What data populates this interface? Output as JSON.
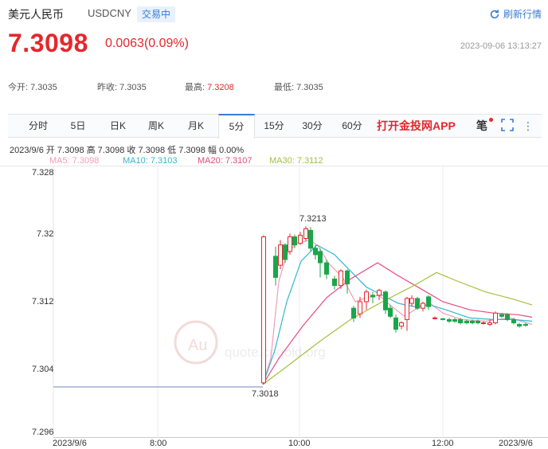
{
  "header": {
    "title": "美元人民币",
    "code": "USDCNY",
    "status": "交易中",
    "refresh_label": "刷新行情"
  },
  "quote": {
    "price": "7.3098",
    "change": "0.0063(0.09%)",
    "timestamp": "2023-09-06 13:13:27"
  },
  "stats": {
    "open_label": "今开:",
    "open": "7.3035",
    "prev_close_label": "昨收:",
    "prev_close": "7.3035",
    "high_label": "最高:",
    "high": "7.3208",
    "low_label": "最低:",
    "low": "7.3035"
  },
  "tabs": [
    {
      "label": "分时"
    },
    {
      "label": "5日"
    },
    {
      "label": "日K"
    },
    {
      "label": "周K"
    },
    {
      "label": "月K"
    },
    {
      "label": "5分",
      "active": true
    },
    {
      "label": "15分"
    },
    {
      "label": "30分"
    },
    {
      "label": "60分"
    }
  ],
  "app_link": "打开金投网APP",
  "toolbar": {
    "brush_glyph": "笔",
    "fullscreen_glyph": "⛶",
    "more_glyph": "⋮"
  },
  "ohlc": "2023/9/6  开 7.3098  高 7.3098  收 7.3098  低 7.3098  幅 0.00%",
  "ma": {
    "ma5": "MA5: 7.3098",
    "ma10": "MA10: 7.3103",
    "ma20": "MA20: 7.3107",
    "ma30": "MA30: 7.3112"
  },
  "colors": {
    "up": "#e4272d",
    "down": "#1aa64a",
    "ma5": "#f39db7",
    "ma10": "#34b7d0",
    "ma20": "#e84a7f",
    "ma30": "#a3c13d",
    "link": "#3a7bd5"
  },
  "chart_data": {
    "type": "candlestick",
    "y_ticks": [
      "7.328",
      "7.32",
      "7.312",
      "7.304",
      "7.296"
    ],
    "y_tick_values": [
      7.328,
      7.32,
      7.312,
      7.304,
      7.296
    ],
    "ylim": [
      7.296,
      7.328
    ],
    "x_ticks": [
      "2023/9/6",
      "8:00",
      "10:00",
      "12:00",
      "2023/9/6"
    ],
    "annotations": {
      "high": "7.3213",
      "low": "7.3018"
    },
    "watermark": "quote.cngold.org"
  }
}
